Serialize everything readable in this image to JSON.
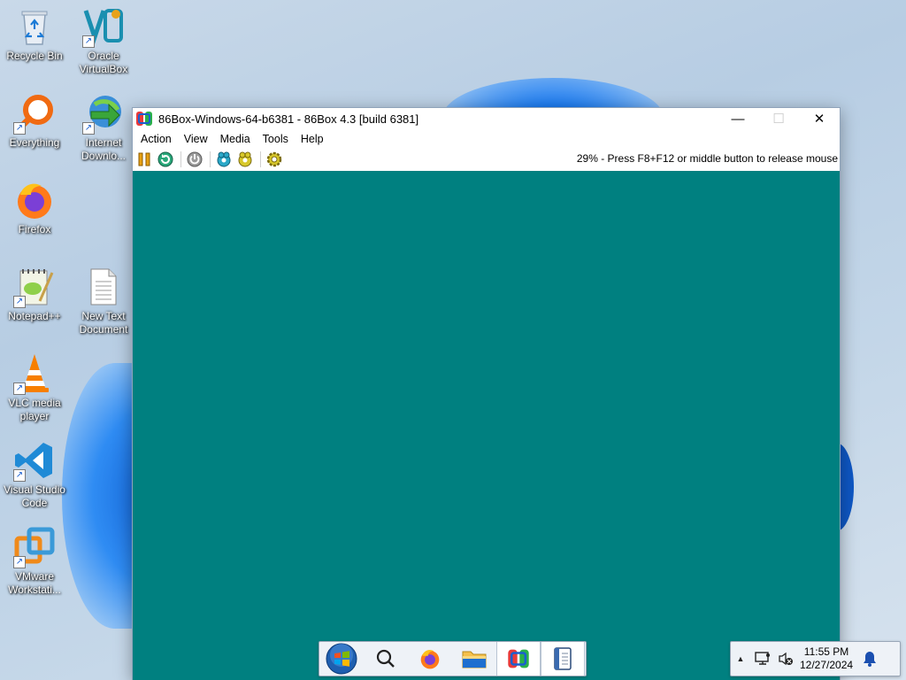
{
  "desktop": {
    "icons": [
      {
        "label": "Recycle Bin",
        "icon": "recycle-bin-icon"
      },
      {
        "label": "Oracle VirtualBox",
        "icon": "virtualbox-icon"
      },
      {
        "label": "Everything",
        "icon": "everything-search-icon"
      },
      {
        "label": "Internet Downlo...",
        "icon": "internet-download-manager-icon"
      },
      {
        "label": "Firefox",
        "icon": "firefox-icon"
      },
      {
        "label": "Notepad++",
        "icon": "notepad-plus-plus-icon"
      },
      {
        "label": "New Text Document",
        "icon": "text-document-icon"
      },
      {
        "label": "VLC media player",
        "icon": "vlc-icon"
      },
      {
        "label": "Visual Studio Code",
        "icon": "vscode-icon"
      },
      {
        "label": "VMware Workstati...",
        "icon": "vmware-icon"
      }
    ]
  },
  "window": {
    "title": "86Box-Windows-64-b6381 - 86Box 4.3 [build 6381]",
    "controls": {
      "minimize": "—",
      "maximize": "☐",
      "close": "✕"
    },
    "menu": [
      "Action",
      "View",
      "Media",
      "Tools",
      "Help"
    ],
    "toolbar": [
      "pause",
      "reset",
      "power",
      "ctrl-alt-del",
      "ctrl-alt-esc",
      "settings"
    ],
    "status": "29% - Press F8+F12 or middle button to release mouse",
    "screen_color": "#008080"
  },
  "taskbar": {
    "items": [
      {
        "name": "start-button",
        "icon": "windows-orb-icon"
      },
      {
        "name": "search-button",
        "icon": "search-icon"
      },
      {
        "name": "firefox-taskbar",
        "icon": "firefox-icon"
      },
      {
        "name": "file-explorer-taskbar",
        "icon": "folder-icon"
      },
      {
        "name": "86box-taskbar",
        "icon": "86box-icon",
        "active": true
      },
      {
        "name": "notepad-taskbar",
        "icon": "notebook-icon"
      }
    ]
  },
  "tray": {
    "expand_icon": "▲",
    "time": "11:55 PM",
    "date": "12/27/2024"
  },
  "colors": {
    "teal_screen": "#008080",
    "accent_blue": "#1a6fe0"
  }
}
